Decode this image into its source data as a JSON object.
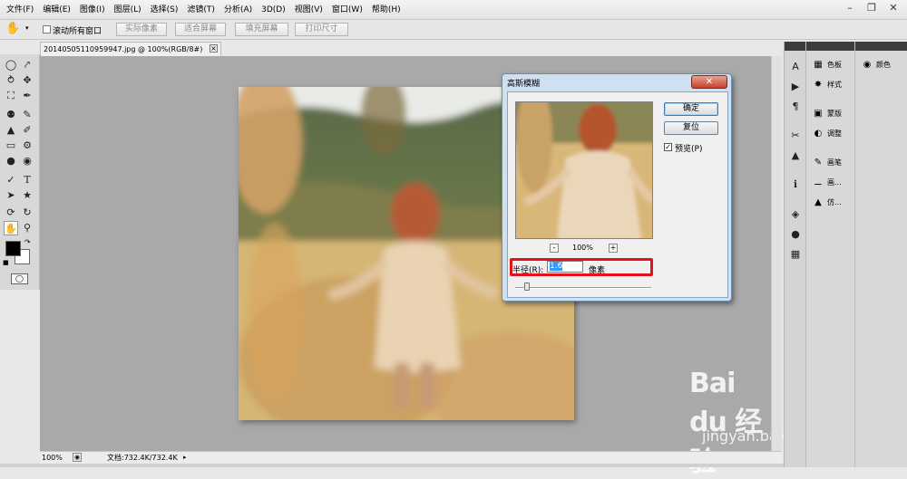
{
  "menu": {
    "items": [
      "文件(F)",
      "编辑(E)",
      "图像(I)",
      "图层(L)",
      "选择(S)",
      "滤镜(T)",
      "分析(A)",
      "3D(D)",
      "视图(V)",
      "窗口(W)",
      "帮助(H)"
    ]
  },
  "options_bar": {
    "scroll_all_label": "滚动所有窗口",
    "scroll_all_checked": false,
    "buttons": [
      "实际像素",
      "适合屏幕",
      "填充屏幕",
      "打印尺寸"
    ]
  },
  "document": {
    "tab_title": "20140505110959947.jpg @ 100%(RGB/8#)",
    "zoom": "100%",
    "doc_info": "文档:732.4K/732.4K"
  },
  "panels": {
    "group1": [
      "色板",
      "样式"
    ],
    "group2": [
      "蒙版",
      "调整"
    ],
    "group3": [
      "画笔",
      "画...",
      "仿..."
    ],
    "color": "颜色"
  },
  "dialog": {
    "title": "高斯模糊",
    "ok": "确定",
    "reset": "复位",
    "preview_label": "预览(P)",
    "preview_checked": true,
    "preview_zoom": "100%",
    "zoom_out": "-",
    "zoom_in": "+",
    "radius_label": "半径(R):",
    "radius_value": "1.6",
    "radius_unit": "像素"
  },
  "watermark": {
    "brand": "Bai du 经验",
    "url": "jingyan.baidu.com"
  },
  "colors": {
    "highlight": "#e0141b",
    "arrow": "#d8201a",
    "dialog_frame": "#cfe0f1"
  }
}
